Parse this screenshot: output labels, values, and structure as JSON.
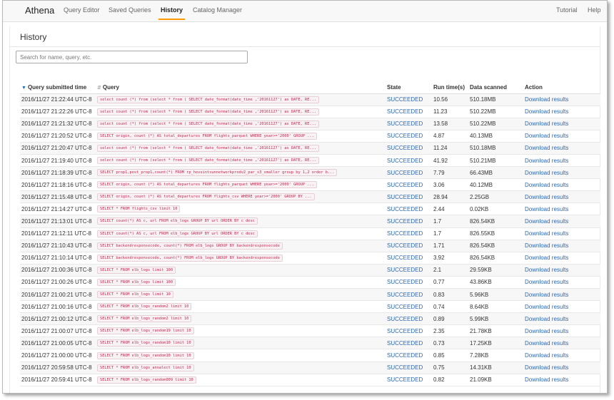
{
  "app": {
    "brand": "Athena"
  },
  "nav": {
    "items": [
      {
        "label": "Query Editor",
        "active": false
      },
      {
        "label": "Saved Queries",
        "active": false
      },
      {
        "label": "History",
        "active": true
      },
      {
        "label": "Catalog Manager",
        "active": false
      }
    ],
    "right": [
      {
        "label": "Tutorial"
      },
      {
        "label": "Help"
      }
    ]
  },
  "page": {
    "title": "History",
    "search_placeholder": "Search for name, query, etc."
  },
  "table": {
    "headers": [
      "Query submitted time",
      "Query",
      "State",
      "Run time(s)",
      "Data scanned",
      "Action"
    ],
    "rows": [
      [
        "2016/11/27 21:22:44 UTC-8",
        "select count (*) from (select * from ( SELECT date_format(date_time ,'20161127') as DATE, RE...",
        "SUCCEEDED",
        "10.56",
        "510.18MB",
        "Download results"
      ],
      [
        "2016/11/27 21:22:26 UTC-8",
        "select count (*) from (select * from ( SELECT date_format(date_time ,'20161127') as DATE, RE...",
        "SUCCEEDED",
        "11.23",
        "510.22MB",
        "Download results"
      ],
      [
        "2016/11/27 21:21:32 UTC-8",
        "select count (*) from (select * from ( SELECT date_format(date_time ,'20161127') as DATE, RE...",
        "SUCCEEDED",
        "13.58",
        "510.22MB",
        "Download results"
      ],
      [
        "2016/11/27 21:20:52 UTC-8",
        "SELECT origin, count (*) AS total_departures FROM flights_parquet WHERE year>='2000' GROUP ...",
        "SUCCEEDED",
        "4.87",
        "40.13MB",
        "Download results"
      ],
      [
        "2016/11/27 21:20:47 UTC-8",
        "select count (*) from (select * from ( SELECT date_format(date_time ,'20161127') as DATE, RE...",
        "SUCCEEDED",
        "11.24",
        "510.18MB",
        "Download results"
      ],
      [
        "2016/11/27 21:19:40 UTC-8",
        "select count (*) from (select * from ( SELECT date_format(date_time ,'20161127') as DATE, RE...",
        "SUCCEEDED",
        "41.92",
        "510.21MB",
        "Download results"
      ],
      [
        "2016/11/27 21:18:39 UTC-8",
        "SELECT prop1,post_prop1,count(*) FROM rp_hevsintsunnetworkprodv2_par_s3_smaller group by 1,2 order b...",
        "SUCCEEDED",
        "7.79",
        "66.43MB",
        "Download results"
      ],
      [
        "2016/11/27 21:18:16 UTC-8",
        "SELECT origin, count (*) AS total_departures FROM flights_parquet WHERE year>='2000' GROUP ...",
        "SUCCEEDED",
        "3.06",
        "40.12MB",
        "Download results"
      ],
      [
        "2016/11/27 21:15:48 UTC-8",
        "SELECT origin, count (*) AS total_departures FROM flights_csv WHERE year>='2000' GROUP BY ...",
        "SUCCEEDED",
        "28.94",
        "2.25GB",
        "Download results"
      ],
      [
        "2016/11/27 21:14:27 UTC-8",
        "SELECT * FROM flights_csv limit 10",
        "SUCCEEDED",
        "2.44",
        "0.02KB",
        "Download results"
      ],
      [
        "2016/11/27 21:13:01 UTC-8",
        "SELECT count(*) AS c, url FROM elb_logs GROUP BY url ORDER BY c desc",
        "SUCCEEDED",
        "1.7",
        "826.54KB",
        "Download results"
      ],
      [
        "2016/11/27 21:12:11 UTC-8",
        "SELECT count(*) AS c, url FROM elb_logs GROUP BY url ORDER BY c desc",
        "SUCCEEDED",
        "1.7",
        "826.55KB",
        "Download results"
      ],
      [
        "2016/11/27 21:10:43 UTC-8",
        "SELECT backendresponsecode, count(*) FROM elb_logs GROUP BY backendresponsecode",
        "SUCCEEDED",
        "1.71",
        "826.54KB",
        "Download results"
      ],
      [
        "2016/11/27 21:10:14 UTC-8",
        "SELECT backendresponsecode, count(*) FROM elb_logs GROUP BY backendresponsecode",
        "SUCCEEDED",
        "3.92",
        "826.54KB",
        "Download results"
      ],
      [
        "2016/11/27 21:00:36 UTC-8",
        "SELECT * FROM elb_logs limit 100",
        "SUCCEEDED",
        "2.1",
        "29.59KB",
        "Download results"
      ],
      [
        "2016/11/27 21:00:26 UTC-8",
        "SELECT * FROM elb_logs limit 100",
        "SUCCEEDED",
        "0.77",
        "43.86KB",
        "Download results"
      ],
      [
        "2016/11/27 21:00:21 UTC-8",
        "SELECT * FROM elb_logs limit 10",
        "SUCCEEDED",
        "0.83",
        "5.96KB",
        "Download results"
      ],
      [
        "2016/11/27 21:00:16 UTC-8",
        "SELECT * FROM elb_logs_random2 limit 10",
        "SUCCEEDED",
        "0.74",
        "8.64KB",
        "Download results"
      ],
      [
        "2016/11/27 21:00:12 UTC-8",
        "SELECT * FROM elb_logs_random2 limit 10",
        "SUCCEEDED",
        "0.89",
        "5.99KB",
        "Download results"
      ],
      [
        "2016/11/27 21:00:07 UTC-8",
        "SELECT * FROM elb_logs_random19 limit 10",
        "SUCCEEDED",
        "2.35",
        "21.78KB",
        "Download results"
      ],
      [
        "2016/11/27 21:00:05 UTC-8",
        "SELECT * FROM elb_logs_random10 limit 10",
        "SUCCEEDED",
        "0.73",
        "17.25KB",
        "Download results"
      ],
      [
        "2016/11/27 21:00:00 UTC-8",
        "SELECT * FROM elb_logs_random10 limit 10",
        "SUCCEEDED",
        "0.85",
        "7.28KB",
        "Download results"
      ],
      [
        "2016/11/27 20:59:58 UTC-8",
        "SELECT * FROM elb_logs_annalect limit 10",
        "SUCCEEDED",
        "0.75",
        "14.31KB",
        "Download results"
      ],
      [
        "2016/11/27 20:59:41 UTC-8",
        "SELECT * FROM elb_logs_random009 limit 10",
        "SUCCEEDED",
        "0.82",
        "21.09KB",
        "Download results"
      ]
    ]
  },
  "colors": {
    "accent": "#ff9900",
    "link": "#2b68b5",
    "code_text": "#c7254e"
  }
}
